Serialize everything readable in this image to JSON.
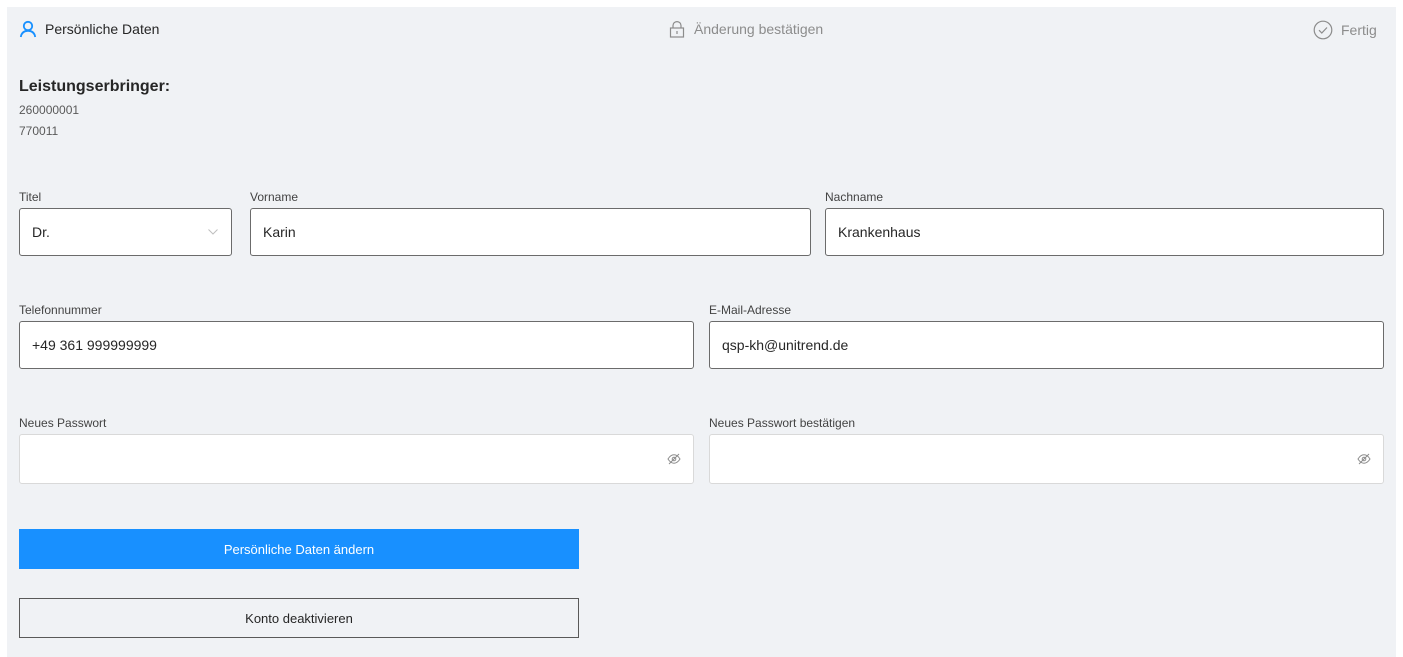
{
  "steps": [
    {
      "label": "Persönliche Daten",
      "icon": "user-icon",
      "state": "active"
    },
    {
      "label": "Änderung bestätigen",
      "icon": "lock-icon",
      "state": "inactive"
    },
    {
      "label": "Fertig",
      "icon": "check-circle-icon",
      "state": "inactive"
    }
  ],
  "provider": {
    "title": "Leistungserbringer:",
    "ids": [
      "260000001",
      "770011"
    ]
  },
  "form": {
    "title": {
      "label": "Titel",
      "value": "Dr."
    },
    "firstname": {
      "label": "Vorname",
      "value": "Karin"
    },
    "lastname": {
      "label": "Nachname",
      "value": "Krankenhaus"
    },
    "phone": {
      "label": "Telefonnummer",
      "value": "+49 361 999999999"
    },
    "email": {
      "label": "E-Mail-Adresse",
      "value": "qsp-kh@unitrend.de"
    },
    "new_password": {
      "label": "Neues Passwort",
      "value": ""
    },
    "confirm_password": {
      "label": "Neues Passwort bestätigen",
      "value": ""
    }
  },
  "buttons": {
    "save": "Persönliche Daten ändern",
    "deactivate": "Konto deaktivieren"
  },
  "colors": {
    "accent": "#1890ff",
    "panel_background": "#f0f2f5"
  }
}
